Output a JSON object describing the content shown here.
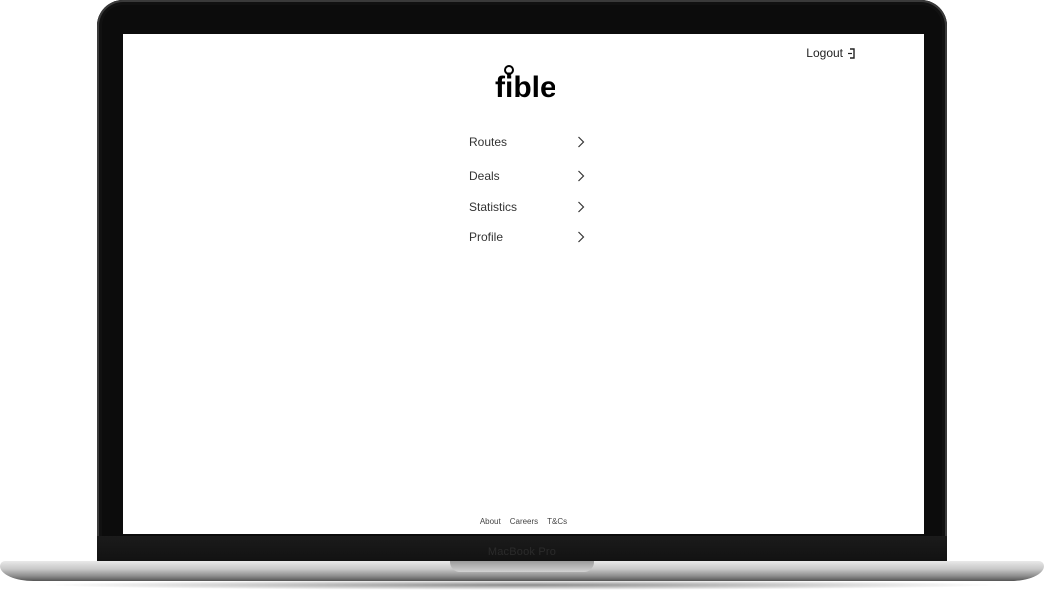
{
  "device": {
    "model_label": "MacBook Pro"
  },
  "header": {
    "logout_label": "Logout",
    "logout_icon": "logout-icon"
  },
  "logo": {
    "text": "fible",
    "icon": "location-pin-icon"
  },
  "menu": {
    "items": [
      {
        "label": "Routes",
        "icon": "chevron-right-icon"
      },
      {
        "label": "Deals",
        "icon": "chevron-right-icon"
      },
      {
        "label": "Statistics",
        "icon": "chevron-right-icon"
      },
      {
        "label": "Profile",
        "icon": "chevron-right-icon"
      }
    ]
  },
  "footer": {
    "links": [
      "About",
      "Careers",
      "T&Cs"
    ]
  },
  "colors": {
    "screen_background": "#ffffff",
    "bezel": "#0c0c0c",
    "text": "#222222"
  }
}
